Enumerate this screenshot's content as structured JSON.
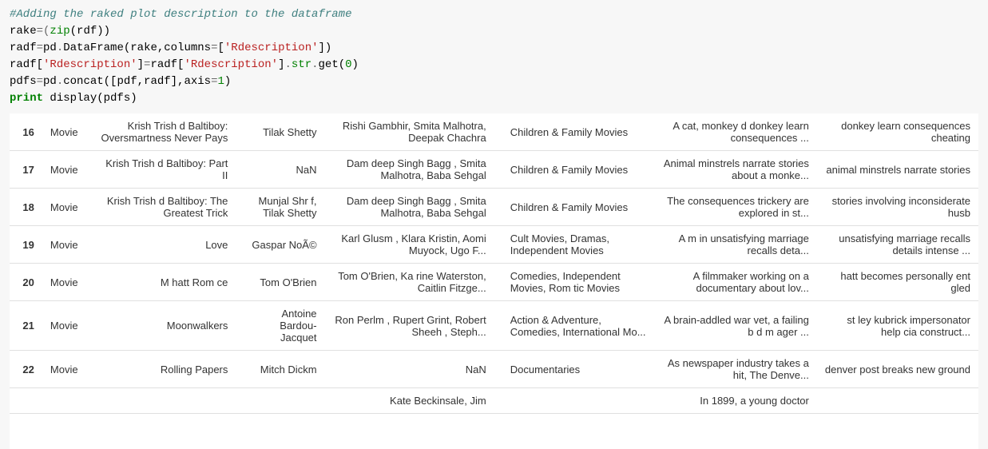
{
  "code": {
    "line1_comment": "#Adding the raked plot description to the dataframe",
    "line2_a": "rake",
    "line2_b": "=(",
    "line2_c": "zip",
    "line2_d": "(rdf))",
    "line3_a": "radf",
    "line3_b": "=",
    "line3_c": "pd",
    "line3_d": ".",
    "line3_e": "DataFrame",
    "line3_f": "(rake,columns",
    "line3_g": "=",
    "line3_h": "[",
    "line3_i": "'Rdescription'",
    "line3_j": "])",
    "line4_a": "radf[",
    "line4_b": "'Rdescription'",
    "line4_c": "]",
    "line4_d": "=",
    "line4_e": "radf[",
    "line4_f": "'Rdescription'",
    "line4_g": "]",
    "line4_h": ".",
    "line4_i": "str",
    "line4_j": ".",
    "line4_k": "get(",
    "line4_l": "0",
    "line4_m": ")",
    "line5_a": "pdfs",
    "line5_b": "=",
    "line5_c": "pd",
    "line5_d": ".",
    "line5_e": "concat([pdf,radf],axis",
    "line5_f": "=",
    "line5_g": "1",
    "line5_h": ")",
    "line6_a": "print",
    "line6_b": " display(pdfs)"
  },
  "rows": [
    {
      "idx": "16",
      "type": "Movie",
      "title": "Krish Trish d Baltiboy: Oversmartness Never Pays",
      "director": "Tilak Shetty",
      "cast": "Rishi Gambhir, Smita Malhotra, Deepak Chachra",
      "genre": "Children & Family Movies",
      "desc": "A cat, monkey d donkey learn consequences ...",
      "rdesc": "donkey learn consequences cheating"
    },
    {
      "idx": "17",
      "type": "Movie",
      "title": "Krish Trish d Baltiboy: Part II",
      "director": "NaN",
      "cast": "Dam deep Singh Bagg , Smita Malhotra, Baba Sehgal",
      "genre": "Children & Family Movies",
      "desc": "Animal minstrels narrate stories about a monke...",
      "rdesc": "animal minstrels narrate stories"
    },
    {
      "idx": "18",
      "type": "Movie",
      "title": "Krish Trish d Baltiboy: The Greatest Trick",
      "director": "Munjal Shr f, Tilak Shetty",
      "cast": "Dam deep Singh Bagg , Smita Malhotra, Baba Sehgal",
      "genre": "Children & Family Movies",
      "desc": "The consequences trickery are explored in st...",
      "rdesc": "stories involving inconsiderate husb"
    },
    {
      "idx": "19",
      "type": "Movie",
      "title": "Love",
      "director": "Gaspar NoÃ©",
      "cast": "Karl Glusm , Klara Kristin, Aomi Muyock, Ugo F...",
      "genre": "Cult Movies, Dramas, Independent Movies",
      "desc": "A m in unsatisfying marriage recalls deta...",
      "rdesc": "unsatisfying marriage recalls details intense ..."
    },
    {
      "idx": "20",
      "type": "Movie",
      "title": "M hatt Rom ce",
      "director": "Tom O'Brien",
      "cast": "Tom O'Brien, Ka rine Waterston, Caitlin Fitzge...",
      "genre": "Comedies, Independent Movies, Rom tic Movies",
      "desc": "A filmmaker working on a documentary about lov...",
      "rdesc": "hatt becomes personally ent gled"
    },
    {
      "idx": "21",
      "type": "Movie",
      "title": "Moonwalkers",
      "director": "Antoine Bardou-Jacquet",
      "cast": "Ron Perlm , Rupert Grint, Robert Sheeh , Steph...",
      "genre": "Action & Adventure, Comedies, International Mo...",
      "desc": "A brain-addled war vet, a failing b d m ager ...",
      "rdesc": "st ley kubrick impersonator help cia construct..."
    },
    {
      "idx": "22",
      "type": "Movie",
      "title": "Rolling Papers",
      "director": "Mitch Dickm",
      "cast": "NaN",
      "genre": "Documentaries",
      "desc": "As newspaper industry takes a hit, The Denve...",
      "rdesc": "denver post breaks new ground"
    }
  ],
  "partial": {
    "cast": "Kate Beckinsale, Jim",
    "desc": "In 1899, a young doctor"
  }
}
